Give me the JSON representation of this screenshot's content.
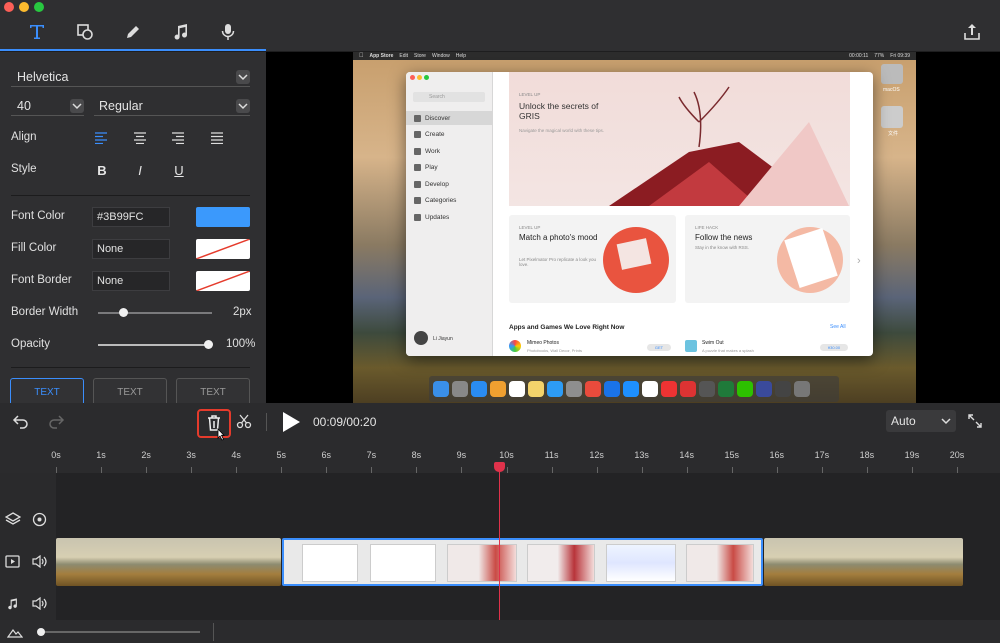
{
  "toolbar": {
    "tools": [
      "text-tool",
      "shape-tool",
      "pen-tool",
      "music-tool",
      "mic-tool"
    ],
    "export_icon": "share-icon"
  },
  "text_panel": {
    "font_family": "Helvetica",
    "font_size": "40",
    "font_weight": "Regular",
    "align_label": "Align",
    "style_label": "Style",
    "style_buttons": [
      "B",
      "I",
      "U"
    ],
    "font_color_label": "Font Color",
    "font_color_value": "#3B99FC",
    "fill_color_label": "Fill Color",
    "fill_color_value": "None",
    "font_border_label": "Font Border",
    "font_border_value": "None",
    "border_width_label": "Border Width",
    "border_width_value": "2px",
    "opacity_label": "Opacity",
    "opacity_value": "100%",
    "presets": [
      "TEXT",
      "TEXT",
      "TEXT"
    ]
  },
  "preview": {
    "menubar": [
      "App Store",
      "Edit",
      "Store",
      "Window",
      "Help"
    ],
    "menubar_right": [
      "00:00:11",
      "77%",
      "Fri 09:39"
    ],
    "store": {
      "search_placeholder": "Search",
      "sidebar": [
        "Discover",
        "Create",
        "Work",
        "Play",
        "Develop",
        "Categories",
        "Updates"
      ],
      "user": "Li Jiayun",
      "hero_kicker": "LEVEL UP",
      "hero_title": "Unlock the secrets of GRIS",
      "hero_sub": "Navigate the magical world with these tips.",
      "card1_kicker": "LEVEL UP",
      "card1_title": "Match a photo's mood",
      "card1_sub": "Let Pixelmator Pro replicate a look you love.",
      "card2_kicker": "LIFE HACK",
      "card2_title": "Follow the news",
      "card2_sub": "Stay in the know with RSS.",
      "section_title": "Apps and Games We Love Right Now",
      "see_all": "See All",
      "app1_name": "Mimeo Photos",
      "app1_sub": "Photobooks, Wall Decor, Prints",
      "app1_btn": "GET",
      "app2_name": "Swim Out",
      "app2_sub": "A puzzle that makes a splash",
      "app2_btn": "¥30.00"
    },
    "desktop_icons": [
      "macOS",
      "文件"
    ]
  },
  "playback": {
    "time": "00:09/00:20",
    "zoom": "Auto"
  },
  "ruler": [
    "0s",
    "1s",
    "2s",
    "3s",
    "4s",
    "5s",
    "6s",
    "7s",
    "8s",
    "9s",
    "10s",
    "11s",
    "12s",
    "13s",
    "14s",
    "15s",
    "16s",
    "17s",
    "18s",
    "19s",
    "20s"
  ],
  "colors": {
    "accent": "#3b8efc",
    "playhead": "#e0324b",
    "highlight": "#e53b2c"
  }
}
